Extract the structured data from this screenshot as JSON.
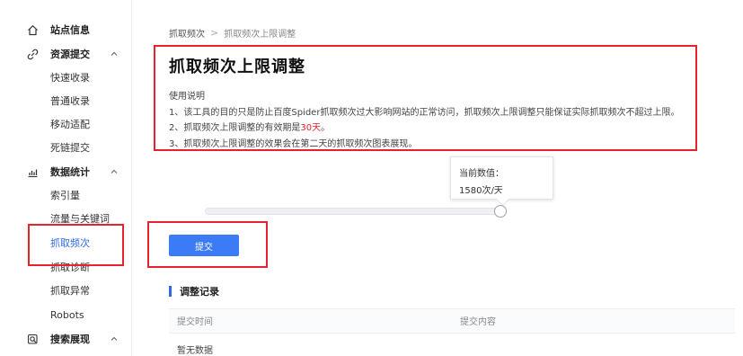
{
  "sidebar": {
    "items": [
      {
        "label": "站点信息",
        "group": true,
        "icon": "home-icon",
        "chevron": false
      },
      {
        "label": "资源提交",
        "group": true,
        "icon": "link-icon",
        "chevron": true
      },
      {
        "label": "快速收录",
        "group": false
      },
      {
        "label": "普通收录",
        "group": false
      },
      {
        "label": "移动适配",
        "group": false
      },
      {
        "label": "死链提交",
        "group": false
      },
      {
        "label": "数据统计",
        "group": true,
        "icon": "bar-chart-icon",
        "chevron": true
      },
      {
        "label": "索引量",
        "group": false
      },
      {
        "label": "流量与关键词",
        "group": false
      },
      {
        "label": "抓取频次",
        "group": false,
        "active": true
      },
      {
        "label": "抓取诊断",
        "group": false
      },
      {
        "label": "抓取异常",
        "group": false
      },
      {
        "label": "Robots",
        "group": false
      },
      {
        "label": "搜索展现",
        "group": true,
        "icon": "search-icon",
        "chevron": true
      }
    ]
  },
  "breadcrumb": {
    "parent": "抓取频次",
    "separator": ">",
    "current": "抓取频次上限调整"
  },
  "page": {
    "title": "抓取频次上限调整",
    "usage_label": "使用说明",
    "note1": "1、该工具的目的只是防止百度Spider抓取频次过大影响网站的正常访问，抓取频次上限调整只能保证实际抓取频次不超过上限。",
    "note2_prefix": "2、抓取频次上限调整的有效期是",
    "note2_highlight": "30天",
    "note2_suffix": "。",
    "note3": "3、抓取频次上限调整的效果会在第二天的抓取频次图表展现。"
  },
  "slider": {
    "tooltip_label": "当前数值：",
    "tooltip_value": "1580次/天",
    "level": 0.985
  },
  "submit_label": "提交",
  "records": {
    "title": "调整记录",
    "columns": [
      "提交时间",
      "提交内容"
    ],
    "empty_text": "暂无数据"
  },
  "colors": {
    "accent": "#3b7cf6",
    "highlight": "#e7222a",
    "annotation_box": "#e7222a"
  }
}
